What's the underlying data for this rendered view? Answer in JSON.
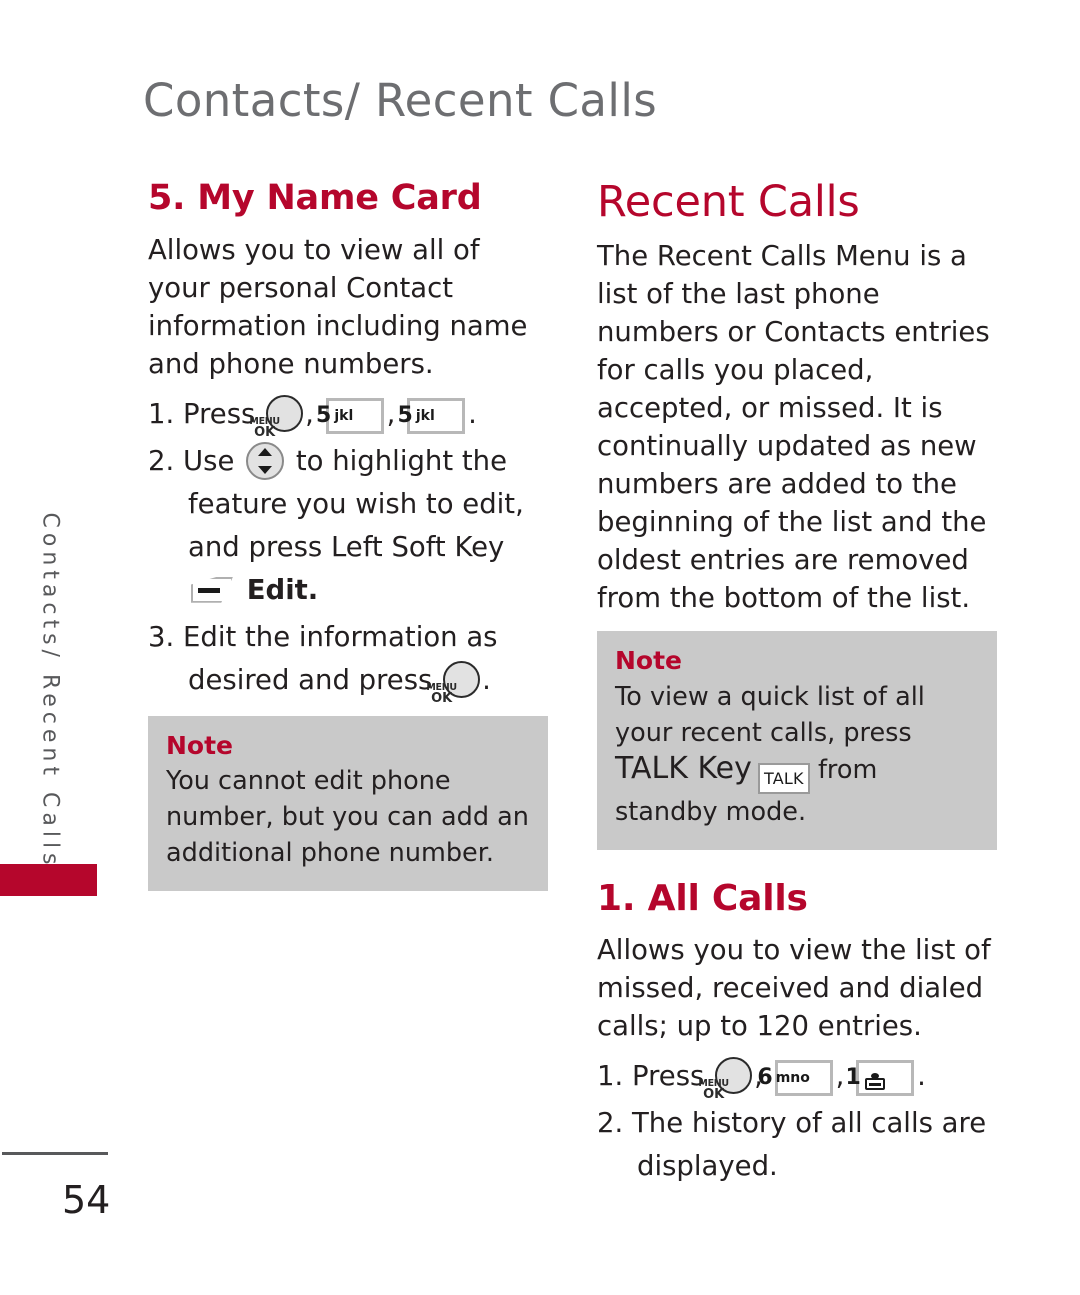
{
  "page": {
    "header": "Contacts/ Recent Calls",
    "side_tab": "Contacts/ Recent Calls",
    "number": "54"
  },
  "left_column": {
    "heading": "5. My Name Card",
    "intro": "Allows you to view all of your personal Contact information including name and phone numbers.",
    "steps": [
      {
        "num": "1.",
        "text_before": "Press",
        "keys": [
          "menu-ok",
          "5-jkl",
          "5-jkl"
        ],
        "text_after": "."
      },
      {
        "num": "2.",
        "part1": "Use",
        "part2": "to highlight the",
        "part3": "feature you wish to edit, and",
        "part4": "press Left Soft Key",
        "part5": "Edit."
      },
      {
        "num": "3.",
        "part1": "Edit the information as",
        "part2": "desired and press",
        "part3": "."
      }
    ],
    "note": {
      "title": "Note",
      "body": "You cannot edit phone number, but you can add an additional phone number."
    }
  },
  "right_column": {
    "heading": "Recent Calls",
    "intro": "The Recent Calls Menu is a list of the last phone numbers or Contacts entries for calls you placed, accepted, or missed. It is continually updated as new numbers are added to the beginning of the list and the oldest entries are removed from the bottom of the list.",
    "note": {
      "title": "Note",
      "body_part1": "To view a quick list of all your recent calls, press",
      "talk_word": "TALK Key",
      "talk_key_label": "TALK",
      "body_part2": "from standby mode."
    },
    "subheading": "1. All Calls",
    "sub_intro": "Allows you to view the list of missed, received and dialed calls; up to 120 entries.",
    "steps": [
      {
        "num": "1.",
        "text_before": "Press",
        "keys": [
          "menu-ok",
          "6-mno",
          "1-voicemail"
        ],
        "text_after": "."
      },
      {
        "num": "2.",
        "part1": "The history of all calls are",
        "part2": "displayed."
      }
    ]
  },
  "keys": {
    "menu_top": "MENU",
    "menu_bottom": "OK",
    "five_digit": "5",
    "five_letters": "jkl",
    "six_digit": "6",
    "six_letters": "mno",
    "one_digit": "1"
  },
  "colors": {
    "accent_red": "#b5062c",
    "header_gray": "#6d6e71",
    "note_gray": "#c9c9c9",
    "body_black": "#231f20"
  }
}
